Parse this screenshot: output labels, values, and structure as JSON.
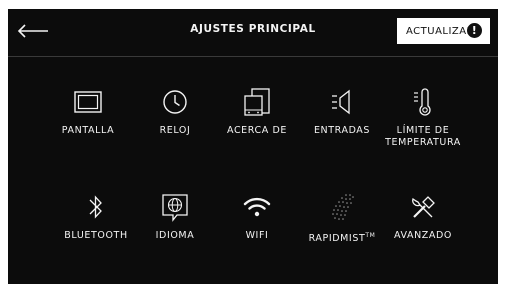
{
  "header": {
    "title": "AJUSTES PRINCIPAL",
    "update_label": "ACTUALIZAR",
    "update_badge": "!"
  },
  "menu": {
    "row1": [
      {
        "label": "PANTALLA",
        "icon": "display-icon"
      },
      {
        "label": "RELOJ",
        "icon": "clock-icon"
      },
      {
        "label": "ACERCA DE",
        "icon": "devices-icon"
      },
      {
        "label": "ENTRADAS",
        "icon": "speaker-icon"
      },
      {
        "label_line1": "LÍMITE DE",
        "label_line2": "TEMPERATURA",
        "icon": "thermometer-icon"
      }
    ],
    "row2": [
      {
        "label": "BLUETOOTH",
        "icon": "bluetooth-icon"
      },
      {
        "label": "IDIOMA",
        "icon": "globe-icon"
      },
      {
        "label": "WIFI",
        "icon": "wifi-icon"
      },
      {
        "label": "RAPIDMIST",
        "label_suffix": "TM",
        "icon": "mist-icon"
      },
      {
        "label": "AVANZADO",
        "icon": "tools-icon"
      }
    ]
  },
  "colors": {
    "background": "#0c0c0c",
    "foreground": "#f4f4f4",
    "button_bg": "#ffffff",
    "button_fg": "#111111"
  }
}
